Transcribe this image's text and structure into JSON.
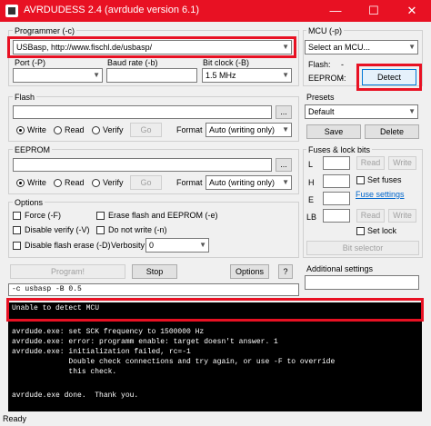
{
  "window": {
    "title": "AVRDUDESS 2.4 (avrdude version 6.1)",
    "minimize": "—",
    "maximize": "☐",
    "close": "✕",
    "app_icon": "avr-chip-icon"
  },
  "programmer": {
    "group_label": "Programmer (-c)",
    "selected": "USBasp, http://www.fischl.de/usbasp/",
    "port_label": "Port (-P)",
    "port_value": "",
    "baud_label": "Baud rate (-b)",
    "baud_value": "",
    "bitclock_label": "Bit clock (-B)",
    "bitclock_value": "1.5 MHz"
  },
  "mcu": {
    "group_label": "MCU (-p)",
    "selected": "Select an MCU...",
    "flash_label": "Flash:",
    "flash_value": "-",
    "eeprom_label": "EEPROM:",
    "eeprom_value": "-",
    "detect_label": "Detect"
  },
  "flash": {
    "group_label": "Flash",
    "browse_label": "...",
    "write_label": "Write",
    "read_label": "Read",
    "verify_label": "Verify",
    "go_label": "Go",
    "format_label": "Format",
    "format_value": "Auto (writing only)"
  },
  "eeprom": {
    "group_label": "EEPROM",
    "browse_label": "...",
    "write_label": "Write",
    "read_label": "Read",
    "verify_label": "Verify",
    "go_label": "Go",
    "format_label": "Format",
    "format_value": "Auto (writing only)"
  },
  "options": {
    "group_label": "Options",
    "force_label": "Force (-F)",
    "erase_label": "Erase flash and EEPROM (-e)",
    "disable_verify_label": "Disable verify (-V)",
    "no_write_label": "Do not write (-n)",
    "disable_erase_label": "Disable flash erase (-D)",
    "verbosity_label": "Verbosity",
    "verbosity_value": "0"
  },
  "actions": {
    "program_label": "Program!",
    "stop_label": "Stop",
    "options_label": "Options",
    "help_label": "?"
  },
  "presets": {
    "group_label": "Presets",
    "selected": "Default",
    "save_label": "Save",
    "delete_label": "Delete"
  },
  "fuses": {
    "group_label": "Fuses & lock bits",
    "l_label": "L",
    "h_label": "H",
    "e_label": "E",
    "lb_label": "LB",
    "read_label": "Read",
    "write_label": "Write",
    "set_fuses_label": "Set fuses",
    "fuse_settings_label": "Fuse settings",
    "set_lock_label": "Set lock",
    "bit_selector_label": "Bit selector"
  },
  "additional": {
    "label": "Additional settings",
    "value": ""
  },
  "command_line": "-c usbasp -B 0.5",
  "console": {
    "lines": [
      "Unable to detect MCU",
      "",
      "avrdude.exe: set SCK frequency to 1500000 Hz",
      "avrdude.exe: error: programm enable: target doesn't answer. 1",
      "avrdude.exe: initialization failed, rc=-1",
      "             Double check connections and try again, or use -F to override",
      "             this check.",
      "",
      "",
      "avrdude.exe done.  Thank you.",
      ""
    ]
  },
  "status": {
    "text": "Ready"
  },
  "colors": {
    "title_bar": "#e81123",
    "highlight_box": "#e81123",
    "console_bg": "#000000",
    "link": "#0066cc"
  }
}
